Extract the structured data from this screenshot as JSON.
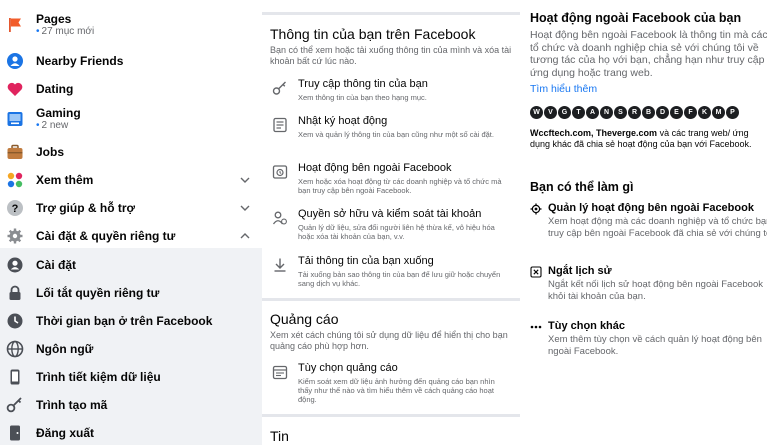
{
  "sidebar": {
    "items": [
      {
        "label": "Pages",
        "sub": "27 mục mới",
        "icon": "flag-icon"
      },
      {
        "label": "Nearby Friends",
        "icon": "nearby-friends-icon"
      },
      {
        "label": "Dating",
        "icon": "heart-icon"
      },
      {
        "label": "Gaming",
        "sub": "2 new",
        "icon": "gaming-icon"
      },
      {
        "label": "Jobs",
        "icon": "briefcase-icon"
      },
      {
        "label": "Xem thêm",
        "icon": "see-more-icon"
      },
      {
        "label": "Trợ giúp & hỗ trợ",
        "icon": "help-icon"
      },
      {
        "label": "Cài đặt & quyền riêng tư",
        "icon": "gear-icon"
      }
    ],
    "sub_items": [
      {
        "label": "Cài đặt",
        "icon": "user-settings-icon"
      },
      {
        "label": "Lối tắt quyền riêng tư",
        "icon": "lock-icon"
      },
      {
        "label": "Thời gian bạn ở trên Facebook",
        "icon": "clock-icon"
      },
      {
        "label": "Ngôn ngữ",
        "icon": "globe-icon"
      },
      {
        "label": "Trình tiết kiệm dữ liệu",
        "icon": "phone-icon"
      },
      {
        "label": "Trình tạo mã",
        "icon": "key-icon"
      },
      {
        "label": "Đăng xuất",
        "icon": "logout-icon"
      }
    ]
  },
  "middle": {
    "info_section": {
      "title": "Thông tin của bạn trên Facebook",
      "desc": "Bạn có thể xem hoặc tải xuống thông tin của mình và xóa tài khoản bất cứ lúc nào.",
      "options": [
        {
          "title": "Truy cập thông tin của bạn",
          "desc": "Xem thông tin của bạn theo hạng mục.",
          "icon": "key-icon"
        },
        {
          "title": "Nhật ký hoạt động",
          "desc": "Xem và quản lý thông tin của bạn cũng như một số cài đặt.",
          "icon": "activity-log-icon"
        },
        {
          "title": "Hoạt động bên ngoài Facebook",
          "desc": "Xem hoặc xóa hoạt động từ các doanh nghiệp và tổ chức mà bạn truy cập bên ngoài Facebook.",
          "icon": "off-facebook-activity-icon"
        },
        {
          "title": "Quyền sở hữu và kiểm soát tài khoản",
          "desc": "Quản lý dữ liệu, sửa đổi người liên hệ thừa kế, vô hiệu hóa hoặc xóa tài khoản của bạn, v.v.",
          "icon": "account-ownership-icon"
        },
        {
          "title": "Tải thông tin của bạn xuống",
          "desc": "Tải xuống bản sao thông tin của bạn để lưu giữ hoặc chuyển sang dịch vụ khác.",
          "icon": "download-icon"
        }
      ]
    },
    "ads_section": {
      "title": "Quảng cáo",
      "desc": "Xem xét cách chúng tôi sử dụng dữ liệu để hiển thị cho bạn quảng cáo phù hợp hơn.",
      "options": [
        {
          "title": "Tùy chọn quảng cáo",
          "desc": "Kiểm soát xem dữ liệu ảnh hưởng đến quảng cáo bạn nhìn thấy như thế nào và tìm hiểu thêm về cách quảng cáo hoạt động.",
          "icon": "ad-preferences-icon"
        }
      ]
    },
    "news_section": {
      "title": "Tin"
    }
  },
  "right": {
    "title": "Hoạt động ngoài Facebook của bạn",
    "desc": "Hoạt động bên ngoài Facebook là thông tin mà các tổ chức và doanh nghiệp chia sẻ với chúng tôi về tương tác của họ với bạn, chẳng hạn như truy cập ứng dụng hoặc trang web.",
    "learn_more": "Tìm hiểu thêm",
    "site_logos": [
      "W",
      "V",
      "G",
      "T",
      "A",
      "N",
      "S",
      "R",
      "B",
      "D",
      "E",
      "F",
      "K",
      "M",
      "P"
    ],
    "sites_bold": "Wccftech.com, Theverge.com",
    "sites_rest": "và các trang web/ ứng dụng khác đã chia sẻ hoạt động của bạn với Facebook.",
    "what_title": "Bạn có thể làm gì",
    "actions": [
      {
        "title": "Quản lý hoạt động bên ngoài Facebook",
        "desc": "Xem hoạt động mà các doanh nghiệp và tổ chức bạn truy cập bên ngoài Facebook đã chia sẻ với chúng tôi.",
        "icon": "manage-gear-icon"
      },
      {
        "title": "Ngắt lịch sử",
        "desc": "Ngắt kết nối lịch sử hoạt động bên ngoài Facebook khỏi tài khoản của bạn.",
        "icon": "clear-history-icon"
      },
      {
        "title": "Tùy chọn khác",
        "desc": "Xem thêm tùy chọn về cách quản lý hoạt động bên ngoài Facebook.",
        "icon": "more-options-icon"
      }
    ]
  }
}
